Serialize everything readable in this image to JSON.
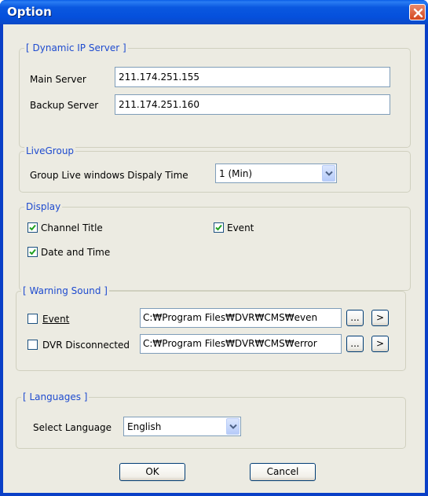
{
  "window": {
    "title": "Option"
  },
  "dynamic_ip": {
    "legend": "[ Dynamic IP Server ]",
    "main_label": "Main Server",
    "main_value": "211.174.251.155",
    "backup_label": "Backup Server",
    "backup_value": "211.174.251.160"
  },
  "live_group": {
    "legend": "LiveGroup",
    "display_time_label": "Group Live windows Dispaly Time",
    "display_time_value": "1 (Min)"
  },
  "display": {
    "legend": "Display",
    "channel_title_label": "Channel Title",
    "channel_title_checked": true,
    "event_label": "Event",
    "event_checked": true,
    "date_time_label": "Date and Time",
    "date_time_checked": true
  },
  "warning_sound": {
    "legend": "[ Warning Sound ]",
    "event_label": "Event",
    "event_checked": false,
    "event_path": "C:₩Program Files₩DVR₩CMS₩even",
    "disconnected_label": "DVR Disconnected",
    "disconnected_checked": false,
    "disconnected_path": "C:₩Program Files₩DVR₩CMS₩error",
    "browse_label": "...",
    "play_label": ">"
  },
  "languages": {
    "legend": "[ Languages ]",
    "select_label": "Select Language",
    "select_value": "English"
  },
  "buttons": {
    "ok": "OK",
    "cancel": "Cancel"
  },
  "icons": {
    "close": "close-icon",
    "dropdown": "chevron-down-icon",
    "check": "checkmark-icon"
  },
  "colors": {
    "title_bar": "#0550dc",
    "group_legend": "#1e4bcf",
    "dialog_face": "#ecebe2",
    "close_button": "#d3461d"
  }
}
